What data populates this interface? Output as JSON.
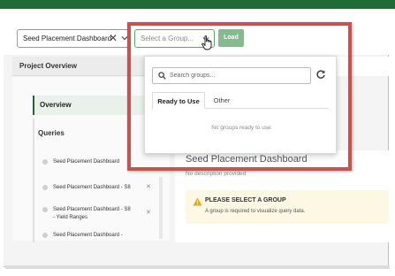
{
  "toolbar": {
    "dashboard_select_value": "Seed Placement Dashboard",
    "dashboard_clear_glyph": "✕",
    "group_select_placeholder": "Select a Group...",
    "load_label": "Load"
  },
  "sidebar": {
    "header": "Project Overview",
    "overview_label": "Overview",
    "queries_label": "Queries",
    "queries": [
      {
        "label": "Seed Placement Dashboard"
      },
      {
        "label": "Seed Placement Dashboard - S8"
      },
      {
        "label_line1": "Seed Placement Dashboard - S8",
        "label_line2": "- Yield Ranges"
      },
      {
        "label": "Seed Placement Dashboard -"
      }
    ]
  },
  "main": {
    "dashboard_title": "Seed Placement Dashboard",
    "description": "No description provided",
    "alert": {
      "title": "PLEASE SELECT A GROUP",
      "text": "A group is required to visualize query data."
    }
  },
  "dropdown": {
    "search_placeholder": "Search groups...",
    "tabs": [
      {
        "label": "Ready to Use",
        "active": true
      },
      {
        "label": "Other",
        "active": false
      }
    ],
    "empty_message": "No groups ready to use"
  },
  "icons": {
    "dashboard_chevron": "chevron-down-icon",
    "group_chevron": "chevron-down-icon",
    "cursor": "hand-pointer-icon",
    "search": "search-icon",
    "refresh": "refresh-icon",
    "warning": "warning-icon",
    "remove": "close-icon"
  },
  "colors": {
    "header_green": "#1f6b35",
    "load_button": "#85ba8f",
    "focus_border": "#62a56f",
    "highlight_border": "#c8524f",
    "alert_background": "#fcf8e3",
    "warning_icon": "#e5a823"
  }
}
